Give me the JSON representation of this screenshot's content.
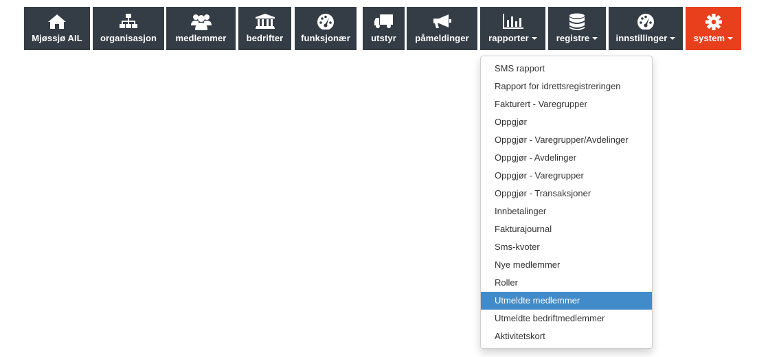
{
  "nav": {
    "items": [
      {
        "label": "Mjøssjø AIL",
        "icon": "home-icon"
      },
      {
        "label": "organisasjon",
        "icon": "sitemap-icon"
      },
      {
        "label": "medlemmer",
        "icon": "users-icon"
      },
      {
        "label": "bedrifter",
        "icon": "bank-icon"
      },
      {
        "label": "funksjonær",
        "icon": "dashboard-icon"
      },
      {
        "label": "utstyr",
        "icon": "truck-icon"
      },
      {
        "label": "påmeldinger",
        "icon": "megaphone-icon"
      },
      {
        "label": "rapporter",
        "icon": "bar-chart-icon",
        "has_caret": true,
        "open": true
      },
      {
        "label": "registre",
        "icon": "database-icon",
        "has_caret": true
      },
      {
        "label": "innstillinger",
        "icon": "dashboard-icon",
        "has_caret": true
      },
      {
        "label": "system",
        "icon": "gear-icon",
        "has_caret": true
      }
    ]
  },
  "dropdown": {
    "items": [
      "SMS rapport",
      "Rapport for idrettsregistreringen",
      "Fakturert - Varegrupper",
      "Oppgjør",
      "Oppgjør - Varegrupper/Avdelinger",
      "Oppgjør - Avdelinger",
      "Oppgjør - Varegrupper",
      "Oppgjør - Transaksjoner",
      "Innbetalinger",
      "Fakturajournal",
      "Sms-kvoter",
      "Nye medlemmer",
      "Roller",
      "Utmeldte medlemmer",
      "Utmeldte bedriftmedlemmer",
      "Aktivitetskort"
    ],
    "highlighted": "Utmeldte medlemmer"
  },
  "colors": {
    "nav_bg": "#343c46",
    "system_bg": "#e8401c",
    "highlight": "#428bca"
  }
}
